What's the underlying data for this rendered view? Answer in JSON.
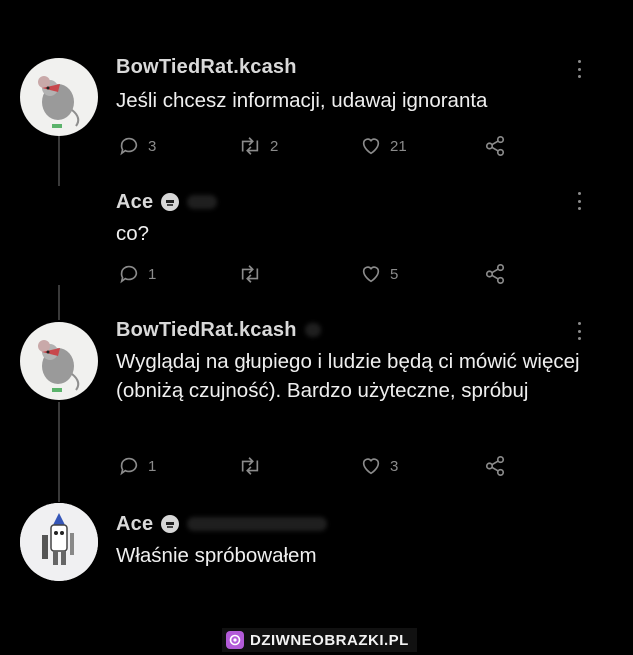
{
  "tweets": [
    {
      "author": "BowTiedRat.kcash",
      "text": "Jeśli chcesz informacji, udawaj ignoranta",
      "reply_count": "3",
      "retweet_count": "2",
      "like_count": "21"
    },
    {
      "author": "Ace",
      "text": "co?",
      "reply_count": "1",
      "retweet_count": "",
      "like_count": "5"
    },
    {
      "author": "BowTiedRat.kcash",
      "text": "Wyglądaj na głupiego i ludzie będą ci mówić więcej (obniżą czujność). Bardzo użyteczne, spróbuj",
      "reply_count": "1",
      "retweet_count": "",
      "like_count": "3"
    },
    {
      "author": "Ace",
      "text": "Właśnie spróbowałem"
    }
  ],
  "watermark": {
    "text": "DZIWNEOBRAZKI.PL"
  },
  "colors": {
    "background": "#000000",
    "text": "#efefef",
    "muted": "#8b8b8b",
    "thread_line": "#3a3a3a",
    "watermark_accent": "#b35bd8"
  }
}
